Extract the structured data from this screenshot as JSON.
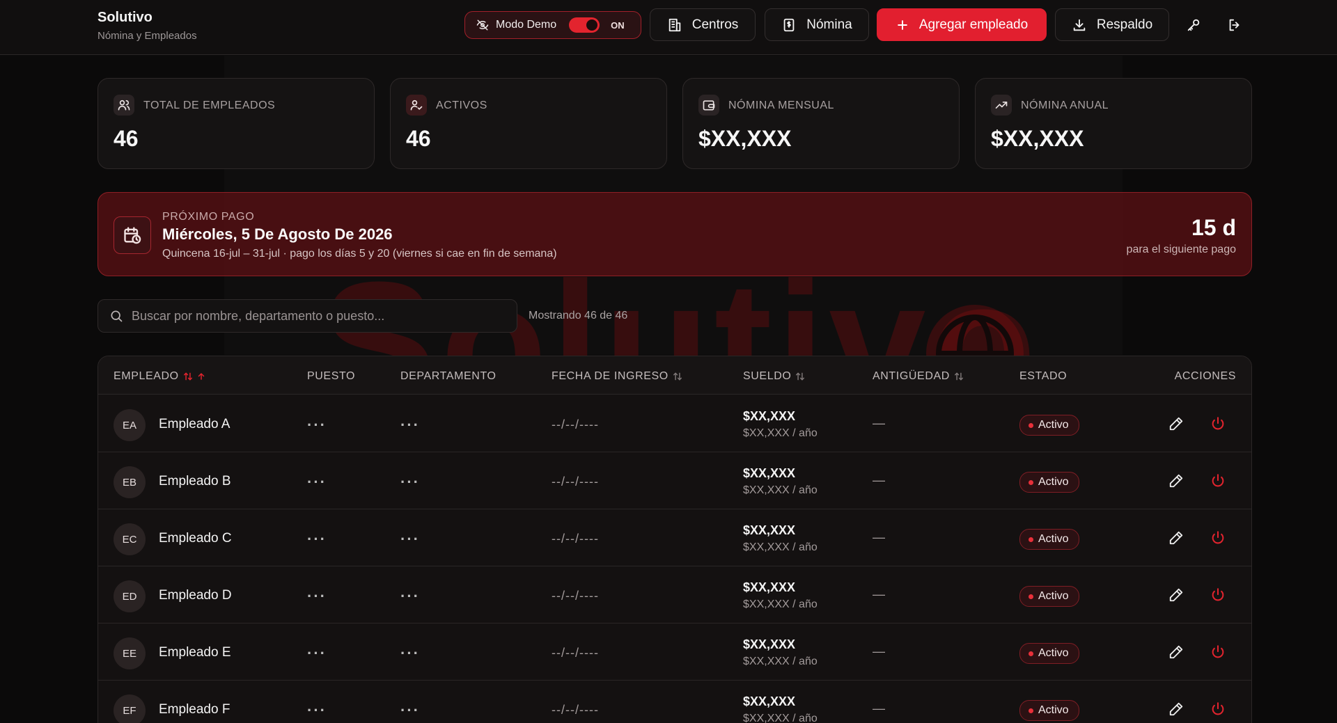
{
  "brand": {
    "title": "Solutivo",
    "subtitle": "Nómina y Empleados"
  },
  "watermark_text": "Solutivo",
  "header": {
    "demo_label": "Modo Demo",
    "demo_state": "ON",
    "centers_label": "Centros",
    "payroll_label": "Nómina",
    "add_label": "Agregar empleado",
    "backup_label": "Respaldo"
  },
  "stats": [
    {
      "label": "TOTAL DE EMPLEADOS",
      "value": "46"
    },
    {
      "label": "ACTIVOS",
      "value": "46"
    },
    {
      "label": "NÓMINA MENSUAL",
      "value": "$XX,XXX"
    },
    {
      "label": "NÓMINA ANUAL",
      "value": "$XX,XXX"
    }
  ],
  "next_payment": {
    "kicker": "PRÓXIMO PAGO",
    "date": "Miércoles, 5 De Agosto De 2026",
    "detail": "Quincena 16-jul – 31-jul · pago los días 5 y 20 (viernes si cae en fin de semana)",
    "days": "15 d",
    "days_sub": "para el siguiente pago"
  },
  "search": {
    "placeholder": "Buscar por nombre, departamento o puesto...",
    "showing": "Mostrando 46 de 46"
  },
  "table": {
    "headers": {
      "employee": "EMPLEADO",
      "position": "PUESTO",
      "department": "DEPARTAMENTO",
      "start_date": "FECHA DE INGRESO",
      "salary": "SUELDO",
      "seniority": "ANTIGÜEDAD",
      "status": "ESTADO",
      "actions": "ACCIONES"
    },
    "rows": [
      {
        "initials": "EA",
        "name": "Empleado A",
        "position": "···",
        "department": "···",
        "start_date": "--/--/----",
        "salary": "$XX,XXX",
        "salary_year": "$XX,XXX / año",
        "seniority": "—",
        "status": "Activo"
      },
      {
        "initials": "EB",
        "name": "Empleado B",
        "position": "···",
        "department": "···",
        "start_date": "--/--/----",
        "salary": "$XX,XXX",
        "salary_year": "$XX,XXX / año",
        "seniority": "—",
        "status": "Activo"
      },
      {
        "initials": "EC",
        "name": "Empleado C",
        "position": "···",
        "department": "···",
        "start_date": "--/--/----",
        "salary": "$XX,XXX",
        "salary_year": "$XX,XXX / año",
        "seniority": "—",
        "status": "Activo"
      },
      {
        "initials": "ED",
        "name": "Empleado D",
        "position": "···",
        "department": "···",
        "start_date": "--/--/----",
        "salary": "$XX,XXX",
        "salary_year": "$XX,XXX / año",
        "seniority": "—",
        "status": "Activo"
      },
      {
        "initials": "EE",
        "name": "Empleado E",
        "position": "···",
        "department": "···",
        "start_date": "--/--/----",
        "salary": "$XX,XXX",
        "salary_year": "$XX,XXX / año",
        "seniority": "—",
        "status": "Activo"
      },
      {
        "initials": "EF",
        "name": "Empleado F",
        "position": "···",
        "department": "···",
        "start_date": "--/--/----",
        "salary": "$XX,XXX",
        "salary_year": "$XX,XXX / año",
        "seniority": "—",
        "status": "Activo"
      }
    ]
  },
  "colors": {
    "accent": "#e21f2f",
    "background": "#0b0a0a",
    "card": "#151313"
  }
}
